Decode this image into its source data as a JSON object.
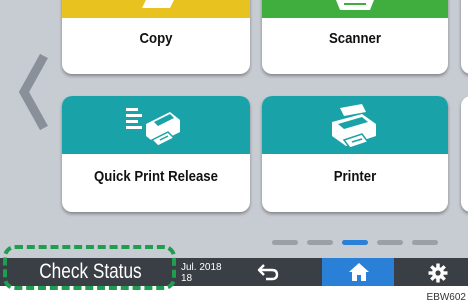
{
  "tiles": [
    {
      "label": "Copy",
      "icon": "copy-icon"
    },
    {
      "label": "Scanner",
      "icon": "scanner-icon"
    },
    {
      "label": "Quick Print Release",
      "icon": "quick-print-release-icon"
    },
    {
      "label": "Printer",
      "icon": "printer-icon"
    }
  ],
  "nav": {
    "previous_icon": "chevron-left-icon"
  },
  "pager": {
    "page_count": 5,
    "active_index": 2
  },
  "bottom_bar": {
    "check_status_label": "Check Status",
    "date_line1": "Jul. 2018",
    "date_line2": "18",
    "back_icon": "back-icon",
    "home_icon": "home-icon",
    "settings_icon": "gear-icon"
  },
  "figure_code": "EBW602",
  "colors": {
    "screen_bg": "#c7ccd2",
    "teal_band": "#19a3a8",
    "yellow_band": "#e8c21e",
    "green_band": "#3fae3f",
    "bar_dark": "#3a3f45",
    "home_blue": "#2a7fd6",
    "highlight_green": "#1f9d50"
  }
}
